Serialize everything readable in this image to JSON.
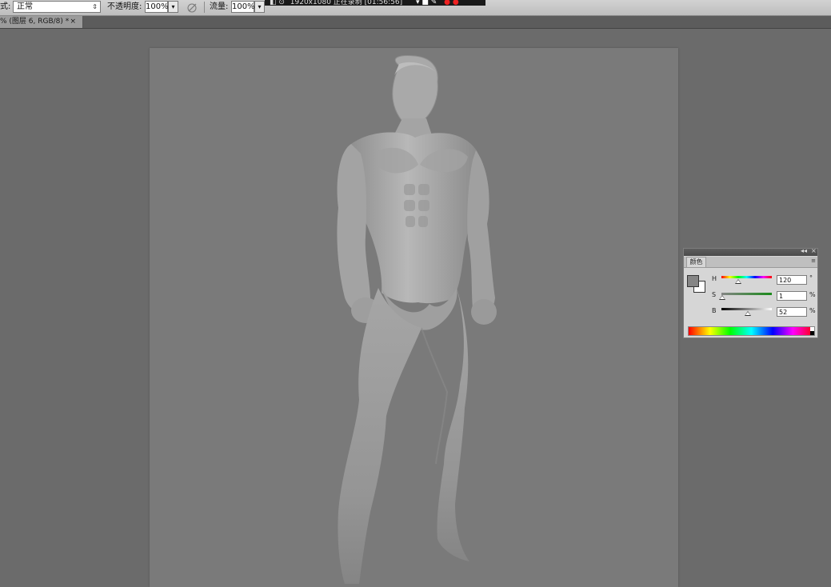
{
  "options_bar": {
    "mode_label": "式:",
    "mode_value": "正常",
    "opacity_label": "不透明度:",
    "opacity_value": "100%",
    "flow_label": "流量:",
    "flow_value": "100%"
  },
  "overlay_bar": {
    "text": "1920x1080  正在录制 [01:56:56]"
  },
  "document_tab": {
    "title": "% (图层 6, RGB/8) *",
    "close": "×"
  },
  "color_panel": {
    "tab_label": "颜色",
    "menu_icon": "≡",
    "titlebar_controls": [
      "◂◂",
      "×"
    ],
    "foreground_color": "#858585",
    "background_color": "#ffffff",
    "channels": [
      {
        "label": "H",
        "value": "120",
        "unit": "°",
        "level": 0.33
      },
      {
        "label": "S",
        "value": "1",
        "unit": "%",
        "level": 0.01
      },
      {
        "label": "B",
        "value": "52",
        "unit": "%",
        "level": 0.52
      }
    ]
  }
}
